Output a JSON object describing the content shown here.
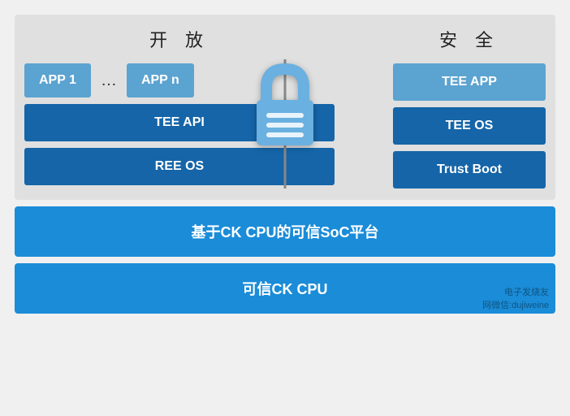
{
  "header": {
    "left_title": "开 放",
    "right_title": "安 全"
  },
  "left_panel": {
    "app1_label": "APP 1",
    "dots_label": "…",
    "appn_label": "APP n",
    "tee_api_label": "TEE API",
    "ree_os_label": "REE OS"
  },
  "right_panel": {
    "tee_app_label": "TEE APP",
    "tee_os_label": "TEE OS",
    "trust_boot_label": "Trust Boot"
  },
  "bottom": {
    "soc_label": "基于CK CPU的可信SoC平台",
    "cpu_label": "可信CK CPU"
  },
  "watermark": {
    "line1": "电子发烧友",
    "line2": "网微信:dujiweine"
  }
}
